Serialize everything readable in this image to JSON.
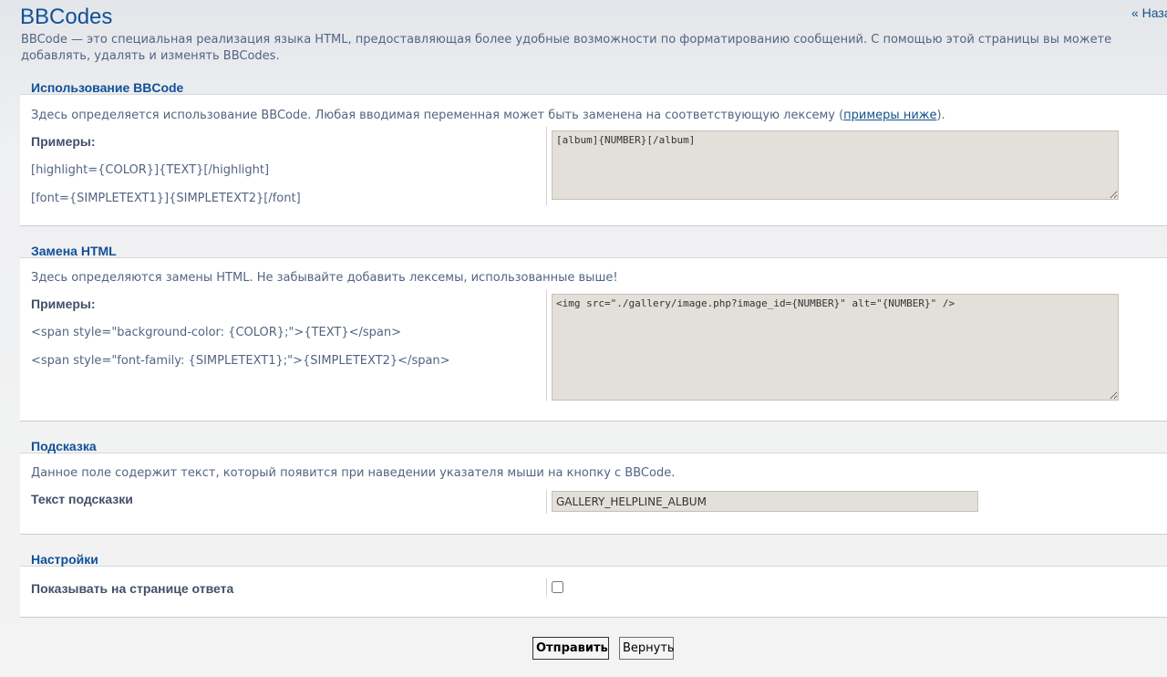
{
  "page": {
    "title": "BBCodes",
    "back_link": "« Назад",
    "intro": "BBCode — это специальная реализация языка HTML, предоставляющая более удобные возможности по форматированию сообщений. С помощью этой страницы вы можете добавлять, удалять и изменять BBCodes."
  },
  "usage": {
    "legend": "Использование BBCode",
    "desc_prefix": "Здесь определяется использование BBCode. Любая вводимая переменная может быть заменена на соответствующую лексему (",
    "desc_link": "примеры ниже",
    "desc_suffix": ").",
    "examples_label": "Примеры:",
    "examples": [
      "[highlight={COLOR}]{TEXT}[/highlight]",
      "[font={SIMPLETEXT1}]{SIMPLETEXT2}[/font]"
    ],
    "value": "[album]{NUMBER}[/album]"
  },
  "html": {
    "legend": "Замена HTML",
    "desc": "Здесь определяются замены HTML. Не забывайте добавить лексемы, использованные выше!",
    "examples_label": "Примеры:",
    "examples": [
      "<span style=\"background-color: {COLOR};\">{TEXT}</span>",
      "<span style=\"font-family: {SIMPLETEXT1};\">{SIMPLETEXT2}</span>"
    ],
    "value": "<img src=\"./gallery/image.php?image_id={NUMBER}\" alt=\"{NUMBER}\" />"
  },
  "helpline": {
    "legend": "Подсказка",
    "desc": "Данное поле содержит текст, который появится при наведении указателя мыши на кнопку с BBCode.",
    "field_label": "Текст подсказки",
    "value": "GALLERY_HELPLINE_ALBUM"
  },
  "settings": {
    "legend": "Настройки",
    "display_label": "Показывать на странице ответа",
    "display_checked": false
  },
  "buttons": {
    "submit": "Отправить",
    "reset": "Вернуть"
  }
}
